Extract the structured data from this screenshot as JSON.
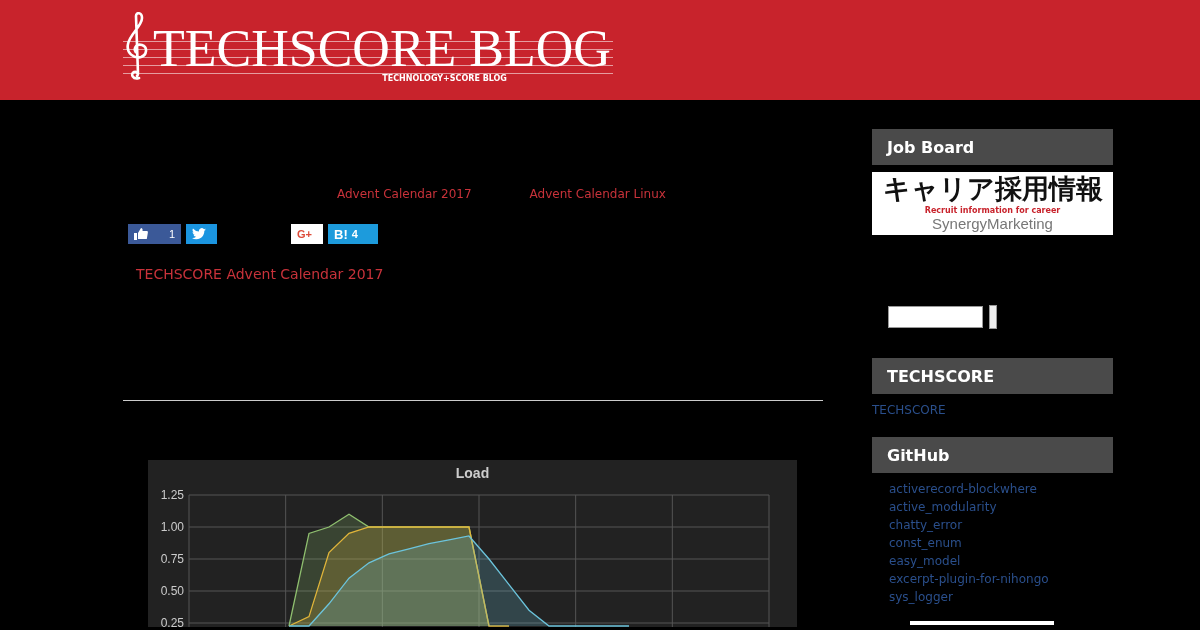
{
  "header": {
    "logo_title": "TECHSCORE BLOG",
    "logo_subtitle": "TECHNOLOGY+SCORE BLOG"
  },
  "article": {
    "category_links": [
      "Advent Calendar 2017",
      "Advent Calendar  Linux"
    ],
    "share_buttons": [
      {
        "kind": "like",
        "count": "1"
      },
      {
        "kind": "tweet"
      },
      {
        "kind": "gplus",
        "label": "G+"
      },
      {
        "kind": "hatena",
        "label": "B!",
        "count": "4"
      }
    ],
    "series_link": "TECHSCORE Advent Calendar 2017",
    "chart": {
      "title": "Load",
      "y_axis_labels": [
        "1.25",
        "1.00",
        "0.75",
        "0.50",
        "0.25"
      ]
    }
  },
  "sidebar": {
    "job_board": {
      "title": "Job Board",
      "banner_title": "キャリア採用情報",
      "banner_subtitle": "Recruit information for career",
      "banner_company": "SynergyMarketing"
    },
    "techscore": {
      "title": "TECHSCORE",
      "links": [
        "TECHSCORE"
      ]
    },
    "github": {
      "title": "GitHub",
      "links": [
        "activerecord-blockwhere",
        "active_modularity",
        "chatty_error",
        "const_enum",
        "easy_model",
        "excerpt-plugin-for-nihongo",
        "sys_logger"
      ]
    }
  }
}
